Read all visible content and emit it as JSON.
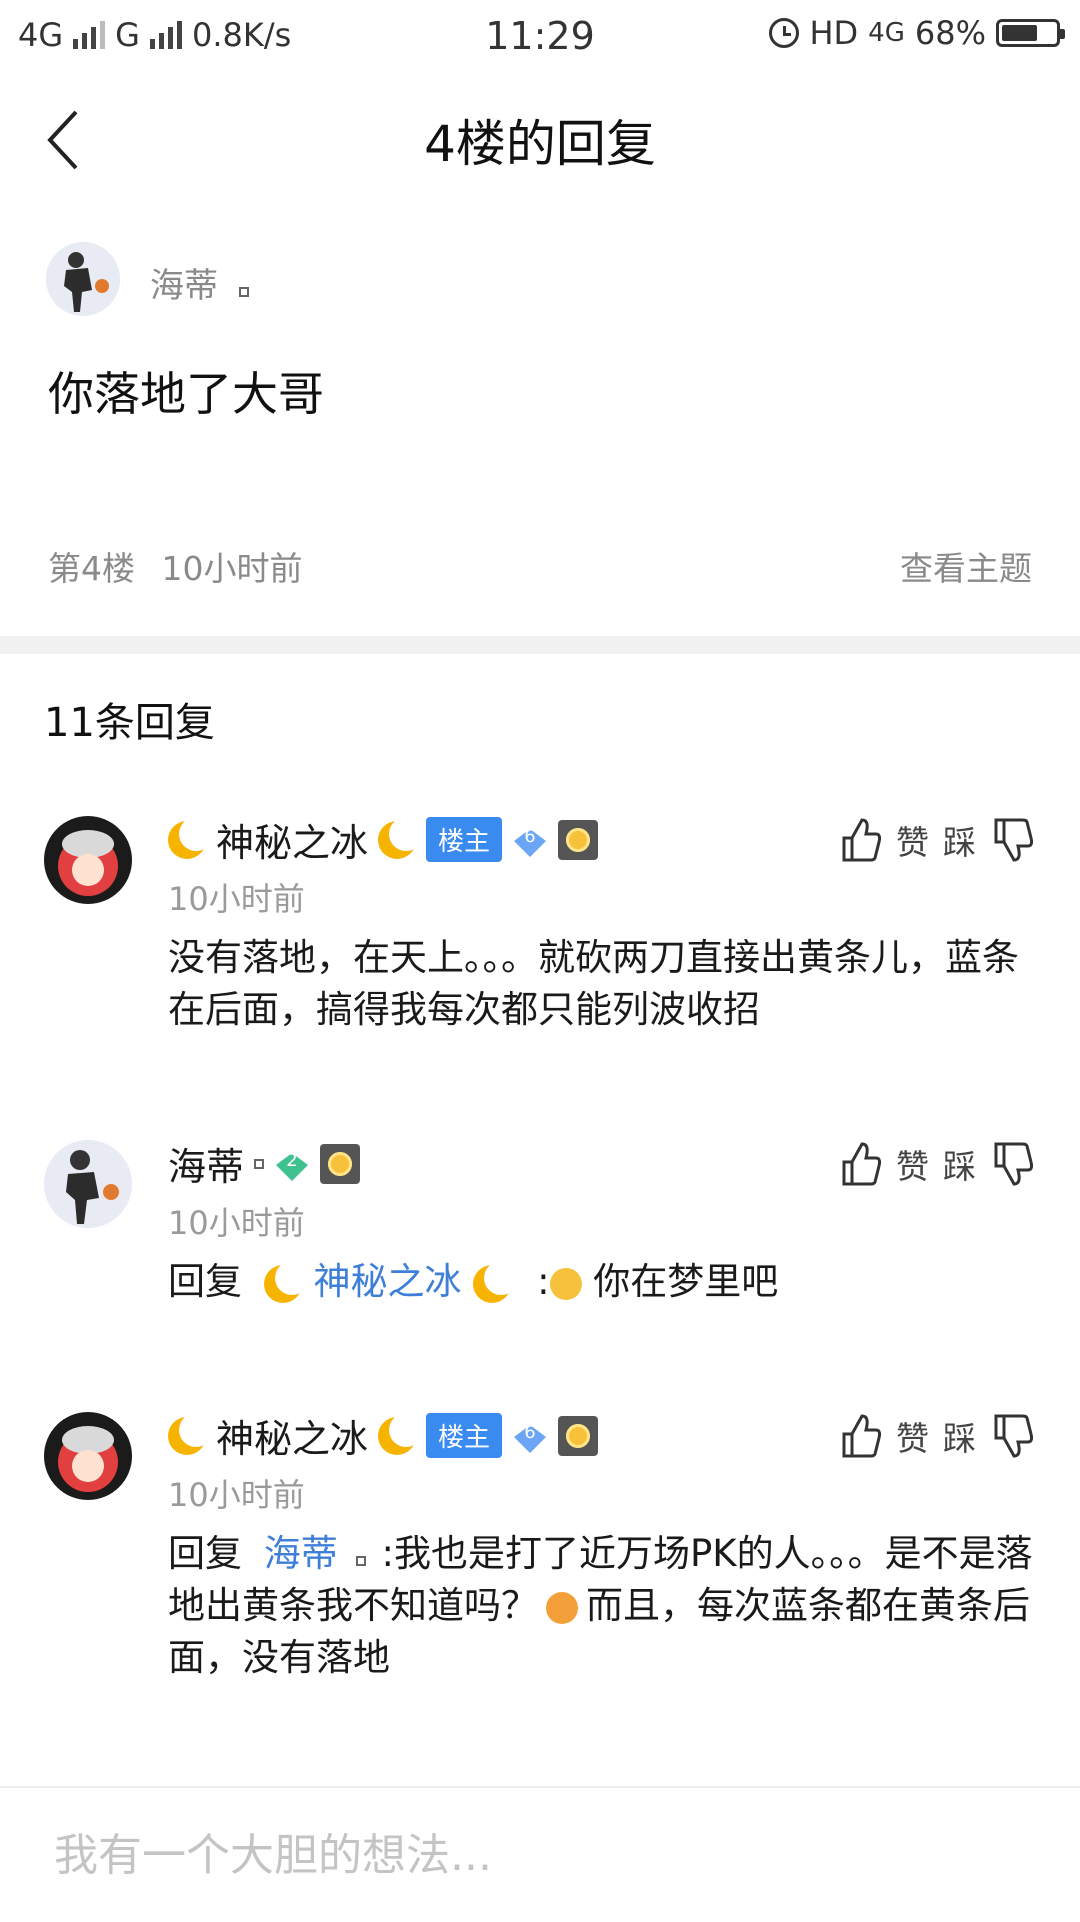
{
  "status_bar": {
    "net1": "4G",
    "net2": "G",
    "speed": "0.8K/s",
    "time": "11:29",
    "hd": "HD",
    "lte": "4G",
    "battery": "68%",
    "battery_level": 0.68
  },
  "header": {
    "title": "4楼的回复",
    "back_icon": "chevron-left-icon"
  },
  "post": {
    "username": "海蒂",
    "content": "你落地了大哥",
    "floor": "第4楼",
    "time": "10小时前",
    "view_topic": "查看主题"
  },
  "reply_count": "11条回复",
  "actions": {
    "like": "赞",
    "dislike": "踩"
  },
  "replies": [
    {
      "username": "神秘之冰",
      "host_badge": "楼主",
      "level": "6",
      "time": "10小时前",
      "content": "没有落地，在天上。。。就砍两刀直接出黄条儿，蓝条在后面，搞得我每次都只能列波收招"
    },
    {
      "username": "海蒂",
      "level": "2",
      "time": "10小时前",
      "reply_prefix": "回复",
      "reply_to": "神秘之冰",
      "content": "你在梦里吧"
    },
    {
      "username": "神秘之冰",
      "host_badge": "楼主",
      "level": "6",
      "time": "10小时前",
      "reply_prefix": "回复",
      "reply_to": "海蒂",
      "content_a": ":我也是打了近万场PK的人。。。是不是落地出黄条我不知道吗？",
      "content_b": "而且，每次蓝条都在黄条后面，没有落地"
    }
  ],
  "comment_input": {
    "placeholder": "我有一个大胆的想法..."
  },
  "colors": {
    "accent": "#3a8bf0",
    "link": "#3f7fd8",
    "muted": "#8a8a8a"
  }
}
